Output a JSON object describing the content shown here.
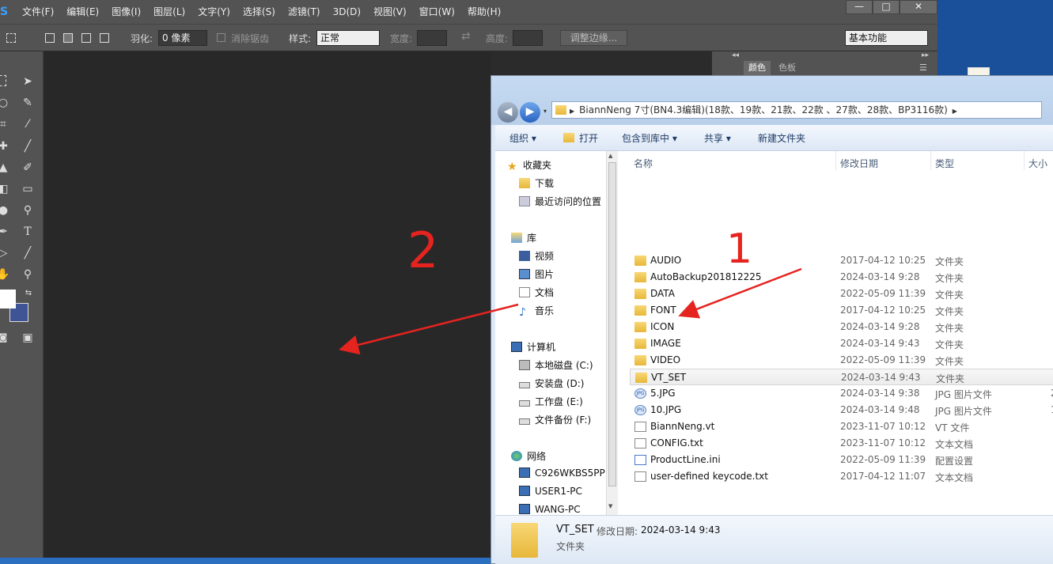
{
  "ps": {
    "logo": "S",
    "menu": [
      "文件(F)",
      "编辑(E)",
      "图像(I)",
      "图层(L)",
      "文字(Y)",
      "选择(S)",
      "滤镜(T)",
      "3D(D)",
      "视图(V)",
      "窗口(W)",
      "帮助(H)"
    ],
    "window_controls": [
      "—",
      "□",
      "✕"
    ],
    "options": {
      "feather_label": "羽化:",
      "feather_value": "0 像素",
      "antialias_label": "消除锯齿",
      "style_label": "样式:",
      "style_value": "正常",
      "width_label": "宽度:",
      "height_label": "高度:",
      "refine_edge": "调整边缘...",
      "workspace": "基本功能"
    },
    "panel_tabs": [
      "颜色",
      "色板"
    ]
  },
  "explorer": {
    "address": "BiannNeng 7寸(BN4.3编辑)(18款、19款、21款、22款 、27款、28款、BP3116款)",
    "commands": {
      "organize": "组织 ▾",
      "open": "打开",
      "include_library": "包含到库中 ▾",
      "share": "共享 ▾",
      "new_folder": "新建文件夹"
    },
    "nav": {
      "favorites": "收藏夹",
      "downloads": "下载",
      "recent": "最近访问的位置",
      "libraries": "库",
      "videos": "视频",
      "pictures": "图片",
      "documents": "文档",
      "music": "音乐",
      "computer": "计算机",
      "drive_c": "本地磁盘 (C:)",
      "drive_d": "安装盘 (D:)",
      "drive_e": "工作盘 (E:)",
      "drive_f": "文件备份 (F:)",
      "network": "网络",
      "pc1": "C926WKBS5PP",
      "pc2": "USER1-PC",
      "pc3": "WANG-PC"
    },
    "columns": {
      "name": "名称",
      "modified": "修改日期",
      "type": "类型",
      "size": "大小"
    },
    "files": [
      {
        "name": "AUDIO",
        "date": "2017-04-12 10:25",
        "type": "文件夹",
        "size": "",
        "icon": "folder"
      },
      {
        "name": "AutoBackup201812225",
        "date": "2024-03-14 9:28",
        "type": "文件夹",
        "size": "",
        "icon": "folder"
      },
      {
        "name": "DATA",
        "date": "2022-05-09 11:39",
        "type": "文件夹",
        "size": "",
        "icon": "folder"
      },
      {
        "name": "FONT",
        "date": "2017-04-12 10:25",
        "type": "文件夹",
        "size": "",
        "icon": "folder"
      },
      {
        "name": "ICON",
        "date": "2024-03-14 9:28",
        "type": "文件夹",
        "size": "",
        "icon": "folder"
      },
      {
        "name": "IMAGE",
        "date": "2024-03-14 9:43",
        "type": "文件夹",
        "size": "",
        "icon": "folder"
      },
      {
        "name": "VIDEO",
        "date": "2022-05-09 11:39",
        "type": "文件夹",
        "size": "",
        "icon": "folder"
      },
      {
        "name": "VT_SET",
        "date": "2024-03-14 9:43",
        "type": "文件夹",
        "size": "",
        "icon": "folder"
      },
      {
        "name": "5.JPG",
        "date": "2024-03-14 9:38",
        "type": "JPG 图片文件",
        "size": "2",
        "icon": "jpg"
      },
      {
        "name": "10.JPG",
        "date": "2024-03-14 9:48",
        "type": "JPG 图片文件",
        "size": "1",
        "icon": "jpg"
      },
      {
        "name": "BiannNeng.vt",
        "date": "2023-11-07 10:12",
        "type": "VT 文件",
        "size": "",
        "icon": "doc"
      },
      {
        "name": "CONFIG.txt",
        "date": "2023-11-07 10:12",
        "type": "文本文档",
        "size": "",
        "icon": "doc"
      },
      {
        "name": "ProductLine.ini",
        "date": "2022-05-09 11:39",
        "type": "配置设置",
        "size": "",
        "icon": "doc"
      },
      {
        "name": "user-defined keycode.txt",
        "date": "2017-04-12 11:07",
        "type": "文本文档",
        "size": "",
        "icon": "doc"
      }
    ],
    "details": {
      "name": "VT_SET",
      "modified_label": "修改日期:",
      "modified_value": "2024-03-14 9:43",
      "type": "文件夹"
    }
  },
  "annotations": {
    "one": "1",
    "two": "2"
  },
  "colors": {
    "arrow": "#e5231f",
    "ps_bg": "#535353",
    "canvas": "#282828",
    "explorer_frame": "#c6dbf2"
  }
}
